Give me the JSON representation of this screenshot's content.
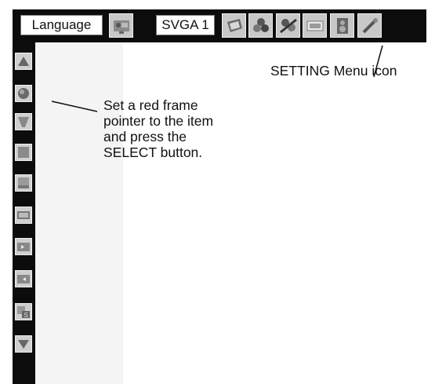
{
  "topbar": {
    "language_label": "Language",
    "resolution_label": "SVGA 1",
    "icons": [
      "computer-adjust-icon",
      "screen-adjust-icon",
      "color-adjust-icon",
      "image-adjust-icon",
      "pc-input-icon",
      "sound-icon",
      "setting-icon"
    ]
  },
  "sidebar": {
    "icons": [
      "scroll-up-icon",
      "round-ball-icon",
      "scroll-down-icon",
      "gray-square-icon",
      "gray-panel-icon",
      "screen-icon",
      "keystone-left-icon",
      "keystone-right-icon",
      "standby-setting-icon",
      "scroll-down-arrow-icon"
    ]
  },
  "callouts": {
    "setting_menu_icon": "SETTING Menu icon",
    "select_instruction": [
      "Set a red frame",
      "pointer to the item",
      "and press the",
      "SELECT button."
    ]
  },
  "colors": {
    "bar": "#0c0c0c",
    "icon_bg": "#c8c8c8"
  }
}
